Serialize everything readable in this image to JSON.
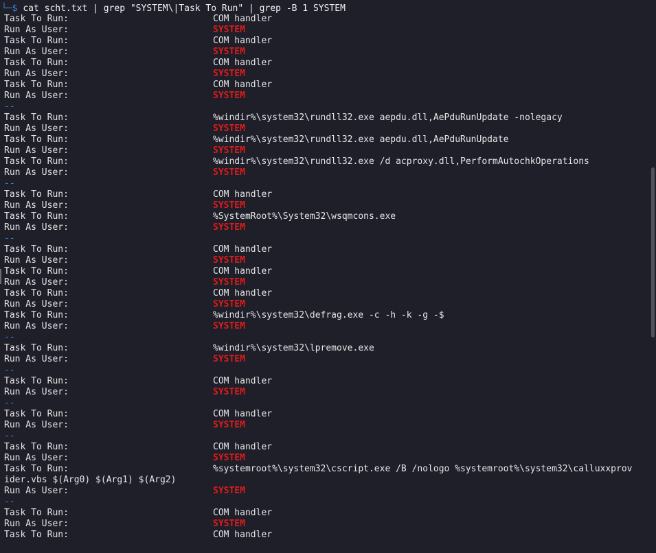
{
  "prompt": {
    "corner": "└─",
    "symbol": "$",
    "command": "cat scht.txt | grep \"SYSTEM\\|Task To Run\" | grep -B 1 SYSTEM"
  },
  "colors": {
    "background": "#1e1f29",
    "text": "#e6e6e6",
    "system_highlight": "#e01b1b",
    "separator": "#3d86d6"
  },
  "lines": [
    {
      "type": "kv",
      "label": "Task To Run:",
      "value": "COM handler"
    },
    {
      "type": "kv",
      "label": "Run As User:",
      "value": "SYSTEM",
      "hl": true
    },
    {
      "type": "kv",
      "label": "Task To Run:",
      "value": "COM handler"
    },
    {
      "type": "kv",
      "label": "Run As User:",
      "value": "SYSTEM",
      "hl": true
    },
    {
      "type": "kv",
      "label": "Task To Run:",
      "value": "COM handler"
    },
    {
      "type": "kv",
      "label": "Run As User:",
      "value": "SYSTEM",
      "hl": true
    },
    {
      "type": "kv",
      "label": "Task To Run:",
      "value": "COM handler"
    },
    {
      "type": "kv",
      "label": "Run As User:",
      "value": "SYSTEM",
      "hl": true
    },
    {
      "type": "sep",
      "text": "--"
    },
    {
      "type": "kv",
      "label": "Task To Run:",
      "value": "%windir%\\system32\\rundll32.exe aepdu.dll,AePduRunUpdate -nolegacy"
    },
    {
      "type": "kv",
      "label": "Run As User:",
      "value": "SYSTEM",
      "hl": true
    },
    {
      "type": "kv",
      "label": "Task To Run:",
      "value": "%windir%\\system32\\rundll32.exe aepdu.dll,AePduRunUpdate"
    },
    {
      "type": "kv",
      "label": "Run As User:",
      "value": "SYSTEM",
      "hl": true
    },
    {
      "type": "kv",
      "label": "Task To Run:",
      "value": "%windir%\\system32\\rundll32.exe /d acproxy.dll,PerformAutochkOperations"
    },
    {
      "type": "kv",
      "label": "Run As User:",
      "value": "SYSTEM",
      "hl": true
    },
    {
      "type": "sep",
      "text": "--"
    },
    {
      "type": "kv",
      "label": "Task To Run:",
      "value": "COM handler"
    },
    {
      "type": "kv",
      "label": "Run As User:",
      "value": "SYSTEM",
      "hl": true
    },
    {
      "type": "kv",
      "label": "Task To Run:",
      "value": "%SystemRoot%\\System32\\wsqmcons.exe"
    },
    {
      "type": "kv",
      "label": "Run As User:",
      "value": "SYSTEM",
      "hl": true
    },
    {
      "type": "sep",
      "text": "--"
    },
    {
      "type": "kv",
      "label": "Task To Run:",
      "value": "COM handler"
    },
    {
      "type": "kv",
      "label": "Run As User:",
      "value": "SYSTEM",
      "hl": true
    },
    {
      "type": "kv",
      "label": "Task To Run:",
      "value": "COM handler"
    },
    {
      "type": "kv",
      "label": "Run As User:",
      "value": "SYSTEM",
      "hl": true
    },
    {
      "type": "kv",
      "label": "Task To Run:",
      "value": "COM handler"
    },
    {
      "type": "kv",
      "label": "Run As User:",
      "value": "SYSTEM",
      "hl": true
    },
    {
      "type": "kv",
      "label": "Task To Run:",
      "value": "%windir%\\system32\\defrag.exe -c -h -k -g -$"
    },
    {
      "type": "kv",
      "label": "Run As User:",
      "value": "SYSTEM",
      "hl": true
    },
    {
      "type": "sep",
      "text": "--"
    },
    {
      "type": "kv",
      "label": "Task To Run:",
      "value": "%windir%\\system32\\lpremove.exe"
    },
    {
      "type": "kv",
      "label": "Run As User:",
      "value": "SYSTEM",
      "hl": true
    },
    {
      "type": "sep",
      "text": "--"
    },
    {
      "type": "kv",
      "label": "Task To Run:",
      "value": "COM handler"
    },
    {
      "type": "kv",
      "label": "Run As User:",
      "value": "SYSTEM",
      "hl": true
    },
    {
      "type": "sep",
      "text": "--"
    },
    {
      "type": "kv",
      "label": "Task To Run:",
      "value": "COM handler"
    },
    {
      "type": "kv",
      "label": "Run As User:",
      "value": "SYSTEM",
      "hl": true
    },
    {
      "type": "sep",
      "text": "--"
    },
    {
      "type": "kv",
      "label": "Task To Run:",
      "value": "COM handler"
    },
    {
      "type": "kv",
      "label": "Run As User:",
      "value": "SYSTEM",
      "hl": true
    },
    {
      "type": "kv",
      "label": "Task To Run:",
      "value": "%systemroot%\\system32\\cscript.exe /B /nologo %systemroot%\\system32\\calluxxprov"
    },
    {
      "type": "wrap",
      "text": "ider.vbs $(Arg0) $(Arg1) $(Arg2)"
    },
    {
      "type": "kv",
      "label": "Run As User:",
      "value": "SYSTEM",
      "hl": true
    },
    {
      "type": "sep",
      "text": "--"
    },
    {
      "type": "kv",
      "label": "Task To Run:",
      "value": "COM handler"
    },
    {
      "type": "kv",
      "label": "Run As User:",
      "value": "SYSTEM",
      "hl": true
    },
    {
      "type": "kv",
      "label": "Task To Run:",
      "value": "COM handler"
    }
  ]
}
